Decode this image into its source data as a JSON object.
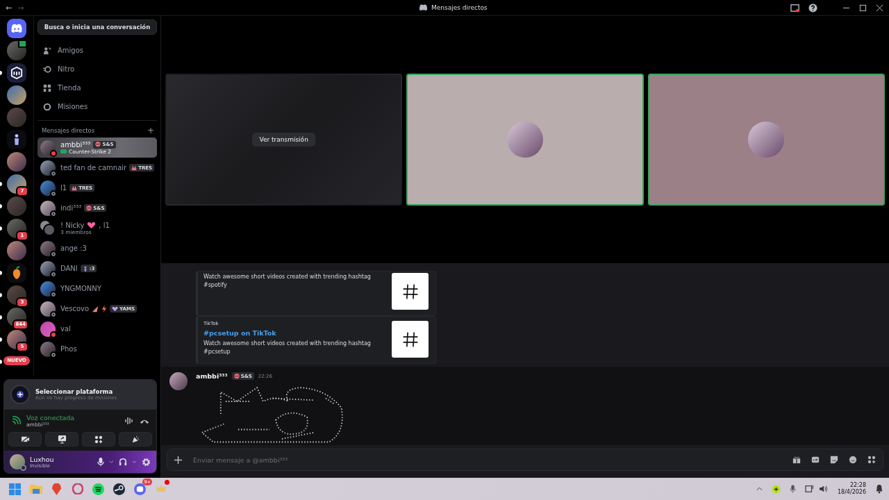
{
  "window": {
    "title": "Mensajes directos"
  },
  "nav_arrows": [
    "←",
    "→"
  ],
  "server_rail": [
    {
      "kind": "home",
      "unread": false
    },
    {
      "kind": "avatar",
      "unread": false,
      "streaming": true
    },
    {
      "kind": "logo",
      "unread": true
    },
    {
      "kind": "avatar",
      "unread": false
    },
    {
      "kind": "avatar",
      "unread": false
    },
    {
      "kind": "figure",
      "unread": false
    },
    {
      "kind": "avatar",
      "unread": false
    },
    {
      "kind": "avatar",
      "unread": true,
      "badge": "7"
    },
    {
      "kind": "avatar",
      "unread": true
    },
    {
      "kind": "avatar",
      "unread": true,
      "badge": "1"
    },
    {
      "kind": "avatar",
      "unread": false
    },
    {
      "kind": "fruit",
      "unread": true
    },
    {
      "kind": "avatar",
      "unread": true,
      "badge": "3"
    },
    {
      "kind": "avatar",
      "unread": true,
      "badge": "844"
    },
    {
      "kind": "avatar",
      "unread": true,
      "badge": "5"
    },
    {
      "kind": "new",
      "unread": true,
      "label": "NUEVO"
    }
  ],
  "search_button": {
    "label": "Busca o inicia una conversación"
  },
  "nav": [
    {
      "kind": "friends",
      "label": "Amigos"
    },
    {
      "kind": "nitro",
      "label": "Nitro"
    },
    {
      "kind": "shop",
      "label": "Tienda"
    },
    {
      "kind": "quests",
      "label": "Misiones"
    }
  ],
  "dm_header": {
    "label": "Mensajes directos",
    "add": "+"
  },
  "dms": [
    {
      "name": "ambbi³³³",
      "tag": {
        "kind": "skull",
        "text": "S&S"
      },
      "activity": "Counter-Strike 2",
      "dnd": true,
      "selected": true
    },
    {
      "name": "ted fan de camnair",
      "tag": {
        "kind": "cake",
        "text": "TRES"
      },
      "dnd": false,
      "selected": false
    },
    {
      "name": "l1",
      "tag": {
        "kind": "cake",
        "text": "TRES"
      },
      "dnd": false,
      "selected": false
    },
    {
      "name": "indi³³³",
      "tag": {
        "kind": "skull",
        "text": "S&S"
      },
      "dnd": false,
      "selected": false
    },
    {
      "name": "! Nicky",
      "emoji": [
        {
          "kind": "heart"
        }
      ],
      "name_suffix": ", l1",
      "subtitle": "3 miembros",
      "group": true,
      "selected": false
    },
    {
      "name": "ange :3",
      "dnd": false,
      "selected": false
    },
    {
      "name": "DANI",
      "tag": {
        "kind": "figure",
        "text": ":3"
      },
      "dnd": false,
      "selected": false
    },
    {
      "name": "YNGMONNY",
      "dnd": false,
      "selected": false
    },
    {
      "name": "Vescovo",
      "emoji": [
        {
          "kind": "wedge"
        },
        {
          "kind": "bolt"
        }
      ],
      "tag": {
        "kind": "heart",
        "text": "YAMS"
      },
      "dnd": false,
      "selected": false
    },
    {
      "name": "val",
      "dnd": true,
      "selected": false
    },
    {
      "name": "Phos",
      "dnd": false,
      "selected": false
    }
  ],
  "quest": {
    "title": "Seleccionar plataforma",
    "subtitle": "Aún no hay progreso de misiones"
  },
  "voice": {
    "status": "Voz conectada",
    "channel": "ambbi³³³",
    "buttons": [
      {
        "kind": "camera-off"
      },
      {
        "kind": "screen-share"
      },
      {
        "kind": "activities"
      },
      {
        "kind": "soundboard"
      }
    ]
  },
  "user": {
    "name": "Luxhou",
    "status": "Invisible"
  },
  "call": {
    "tiles": [
      {
        "kind": "stream",
        "button": "Ver transmisión",
        "speaking": false
      },
      {
        "kind": "user",
        "speaking": true
      },
      {
        "kind": "user",
        "speaking": true
      }
    ]
  },
  "chat": {
    "embeds": [
      {
        "description": "Watch awesome short videos created with trending hashtag #spotify"
      },
      {
        "provider": "TikTok",
        "title": "#pcsetup on TikTok",
        "description": "Watch awesome short videos created with trending hashtag #pcsetup"
      }
    ],
    "message": {
      "author": "ambbi³³³",
      "tag": {
        "kind": "skull",
        "text": "S&S"
      },
      "time": "22:26"
    },
    "input": {
      "placeholder": "Enviar mensaje a @ambbi³³³"
    }
  },
  "taskbar": {
    "apps": [
      {
        "kind": "start"
      },
      {
        "kind": "files"
      },
      {
        "kind": "brave"
      },
      {
        "kind": "opera"
      },
      {
        "kind": "spotify"
      },
      {
        "kind": "steam"
      },
      {
        "kind": "discord",
        "badge": "9+"
      },
      {
        "kind": "game",
        "alert": true
      }
    ],
    "time": "22:28",
    "date": "18/4/2026"
  }
}
